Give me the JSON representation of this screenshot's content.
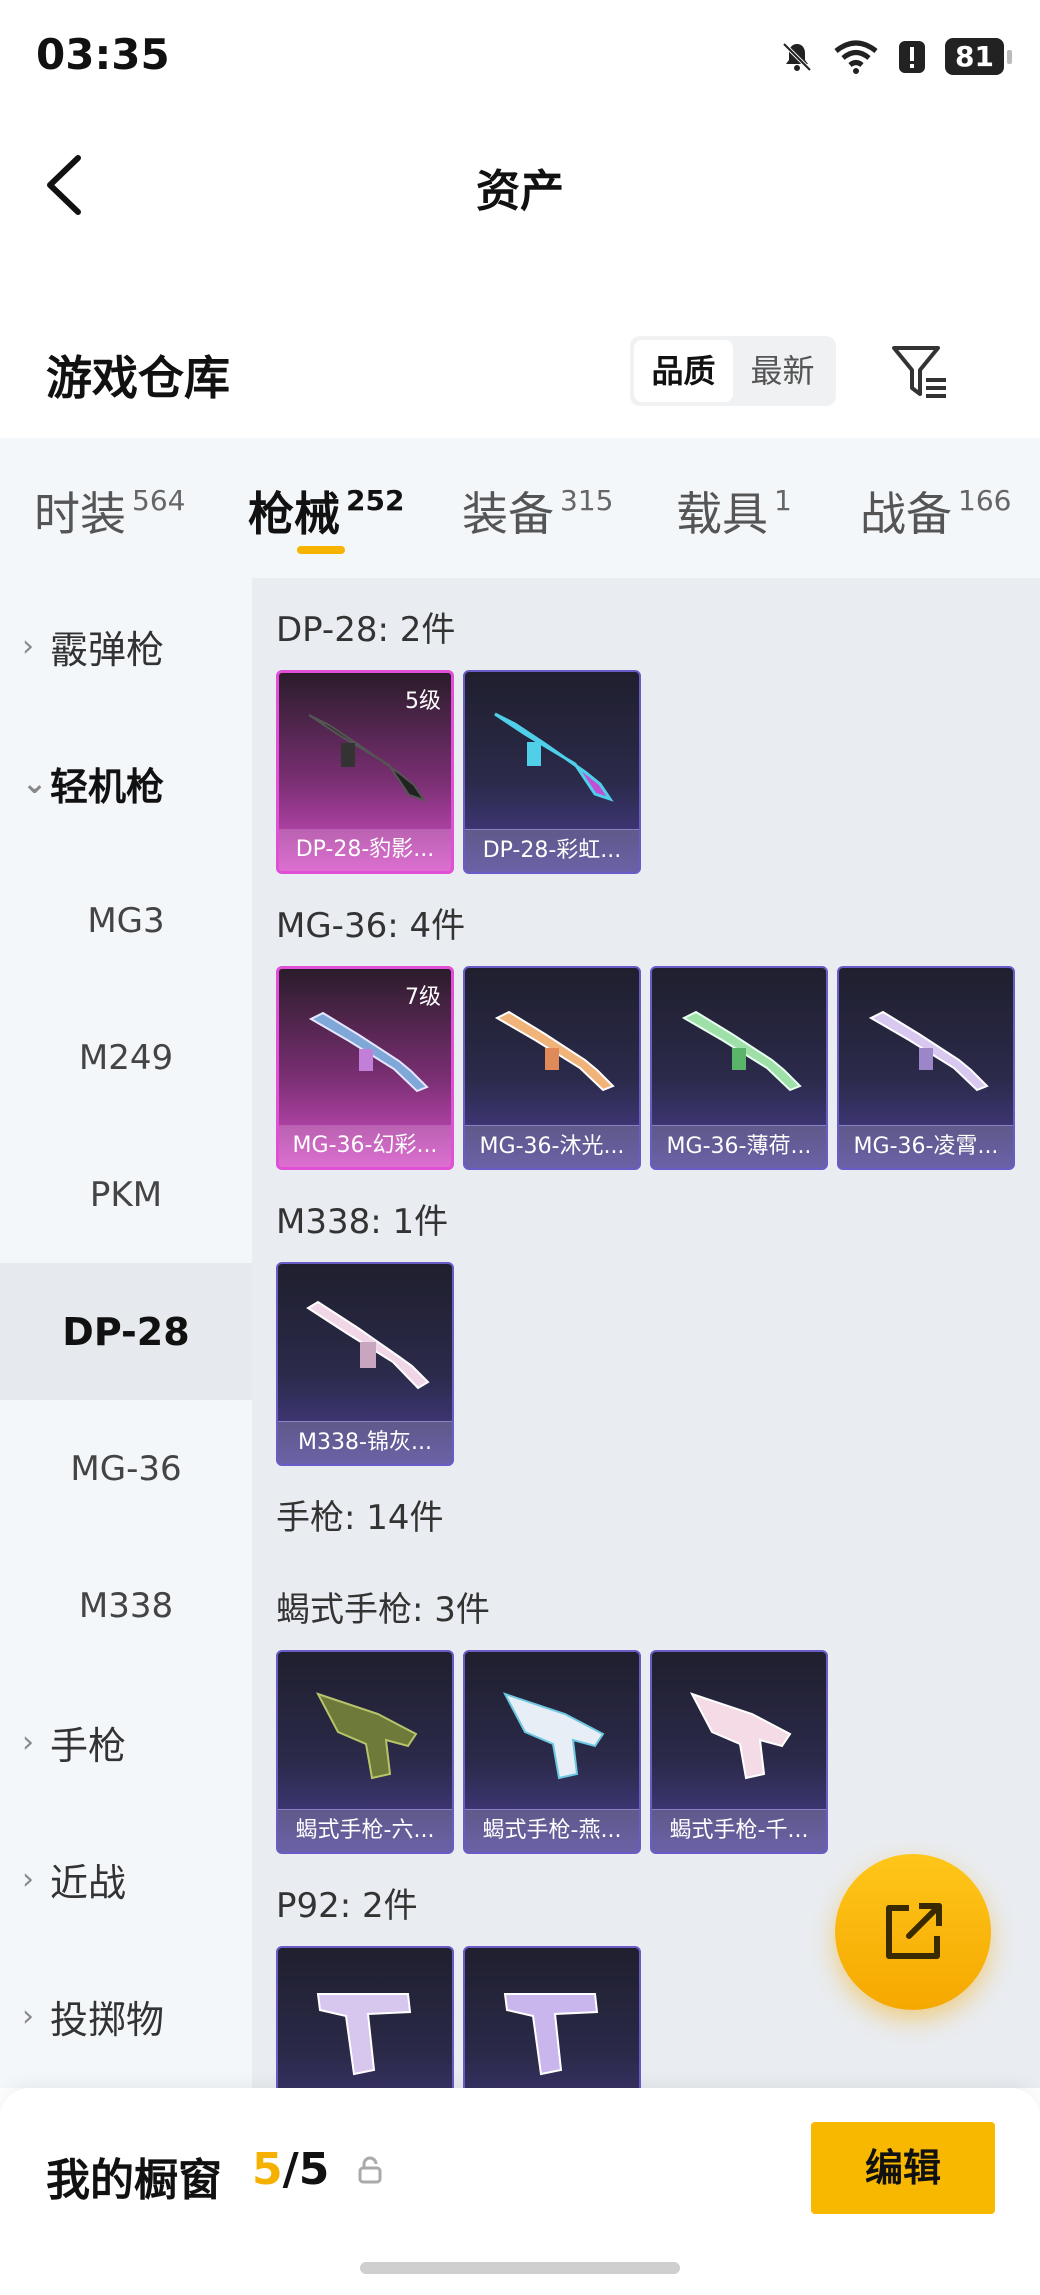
{
  "status_bar": {
    "time": "03:35",
    "battery": "81"
  },
  "header": {
    "title": "资产"
  },
  "warehouse": {
    "title": "游戏仓库",
    "sort_options": [
      "品质",
      "最新"
    ],
    "sort_selected": "品质"
  },
  "tabs": [
    {
      "label": "时装",
      "count": "564"
    },
    {
      "label": "枪械",
      "count": "252"
    },
    {
      "label": "装备",
      "count": "315"
    },
    {
      "label": "载具",
      "count": "1"
    },
    {
      "label": "战备",
      "count": "166"
    }
  ],
  "active_tab": "枪械",
  "sidebar": {
    "groups": [
      "霰弹枪",
      "轻机枪",
      "手枪",
      "近战",
      "投掷物"
    ],
    "subitems": [
      "MG3",
      "M249",
      "PKM",
      "DP-28",
      "MG-36",
      "M338"
    ],
    "selected": "DP-28"
  },
  "content": {
    "groups": [
      {
        "label": "DP-28: 2件",
        "items": [
          {
            "name": "DP-28-豹影...",
            "level": "5级"
          },
          {
            "name": "DP-28-彩虹..."
          }
        ]
      },
      {
        "label": "MG-36: 4件",
        "items": [
          {
            "name": "MG-36-幻彩...",
            "level": "7级"
          },
          {
            "name": "MG-36-沐光..."
          },
          {
            "name": "MG-36-薄荷..."
          },
          {
            "name": "MG-36-凌霄..."
          }
        ]
      },
      {
        "label": "M338: 1件",
        "items": [
          {
            "name": "M338-锦灰..."
          }
        ]
      },
      {
        "label": "手枪: 14件"
      },
      {
        "label": "蝎式手枪: 3件",
        "items": [
          {
            "name": "蝎式手枪-六..."
          },
          {
            "name": "蝎式手枪-燕..."
          },
          {
            "name": "蝎式手枪-千..."
          }
        ]
      },
      {
        "label": "P92: 2件",
        "items": [
          {},
          {}
        ]
      }
    ]
  },
  "showcase": {
    "label": "我的橱窗",
    "current": "5",
    "total": "/5",
    "edit_label": "编辑"
  },
  "colors": {
    "accent": "#f9b800",
    "rarity_purple": "#6a5cc7",
    "rarity_pink": "#e04fd5"
  }
}
